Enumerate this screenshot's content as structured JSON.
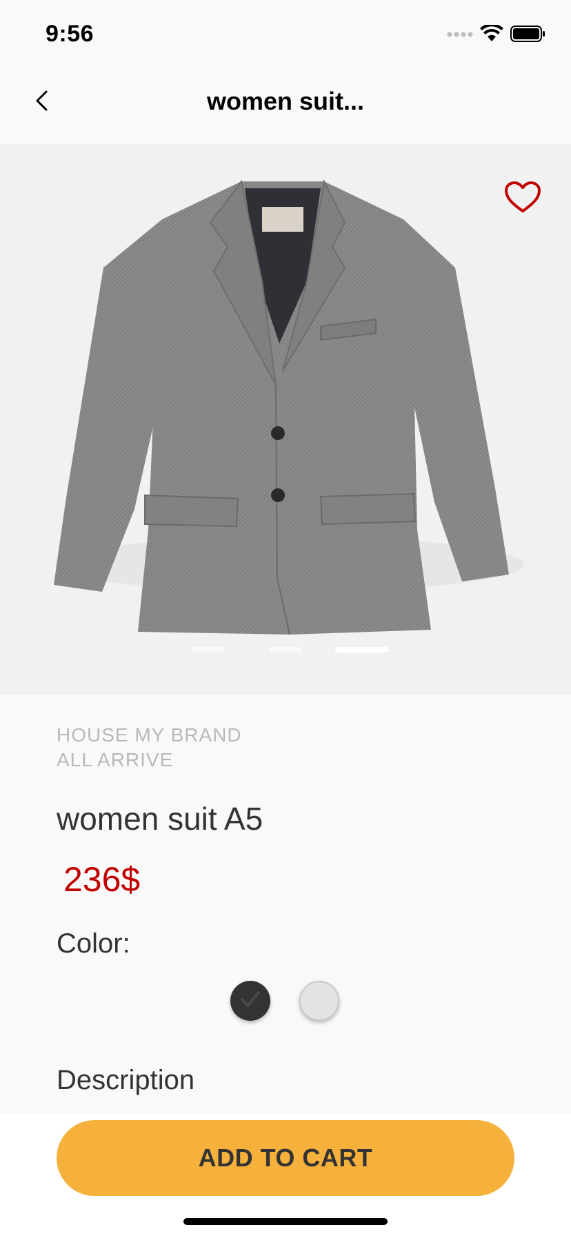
{
  "status_bar": {
    "time": "9:56",
    "icons": [
      "signal-icon",
      "wifi-icon",
      "battery-icon"
    ]
  },
  "nav": {
    "back_icon": "chevron-left-icon",
    "title": "women suit..."
  },
  "product": {
    "image_alt": "gray wool blazer",
    "favorite_icon": "heart-outline-icon",
    "image_count": 3,
    "active_image_index": 2,
    "brand_lines": [
      "HOUSE MY BRAND",
      "ALL ARRIVE"
    ],
    "name": "women suit A5",
    "price": "236$",
    "color_label": "Color:",
    "colors": [
      {
        "name": "dark gray",
        "hex": "#333333",
        "selected": true
      },
      {
        "name": "light gray",
        "hex": "#e3e3e3",
        "selected": false
      }
    ],
    "description_label": "Description"
  },
  "actions": {
    "add_to_cart": "ADD TO CART"
  },
  "theme": {
    "accent": "#f6b13d",
    "price_color": "#c00000",
    "heart_color": "#c00000"
  }
}
